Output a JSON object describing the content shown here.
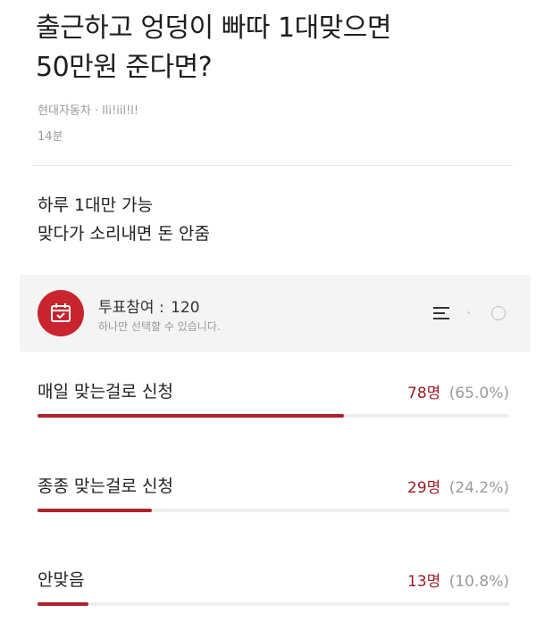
{
  "post": {
    "title_line1": "출근하고 엉덩이 빠따 1대맞으면",
    "title_line2": "50만원 준다면?",
    "author": "현대자동차 · lli!iil!l!",
    "time": "14분",
    "body_line1": "하루 1대만 가능",
    "body_line2": "맞다가 소리내면 돈 안줌"
  },
  "poll": {
    "participants_label": "투표참여 :",
    "participants": "120",
    "instruction": "하나만 선택할 수 있습니다.",
    "icons": [
      "calendar-vote-icon",
      "sort-icon",
      "radio-icon"
    ],
    "accent_color": "#c8252f",
    "options": [
      {
        "label": "매일 맞는걸로 신청",
        "votes": "78명",
        "percent": "(65.0%)",
        "fraction": 0.65
      },
      {
        "label": "종종 맞는걸로 신청",
        "votes": "29명",
        "percent": "(24.2%)",
        "fraction": 0.242
      },
      {
        "label": "안맞음",
        "votes": "13명",
        "percent": "(10.8%)",
        "fraction": 0.108
      }
    ]
  }
}
